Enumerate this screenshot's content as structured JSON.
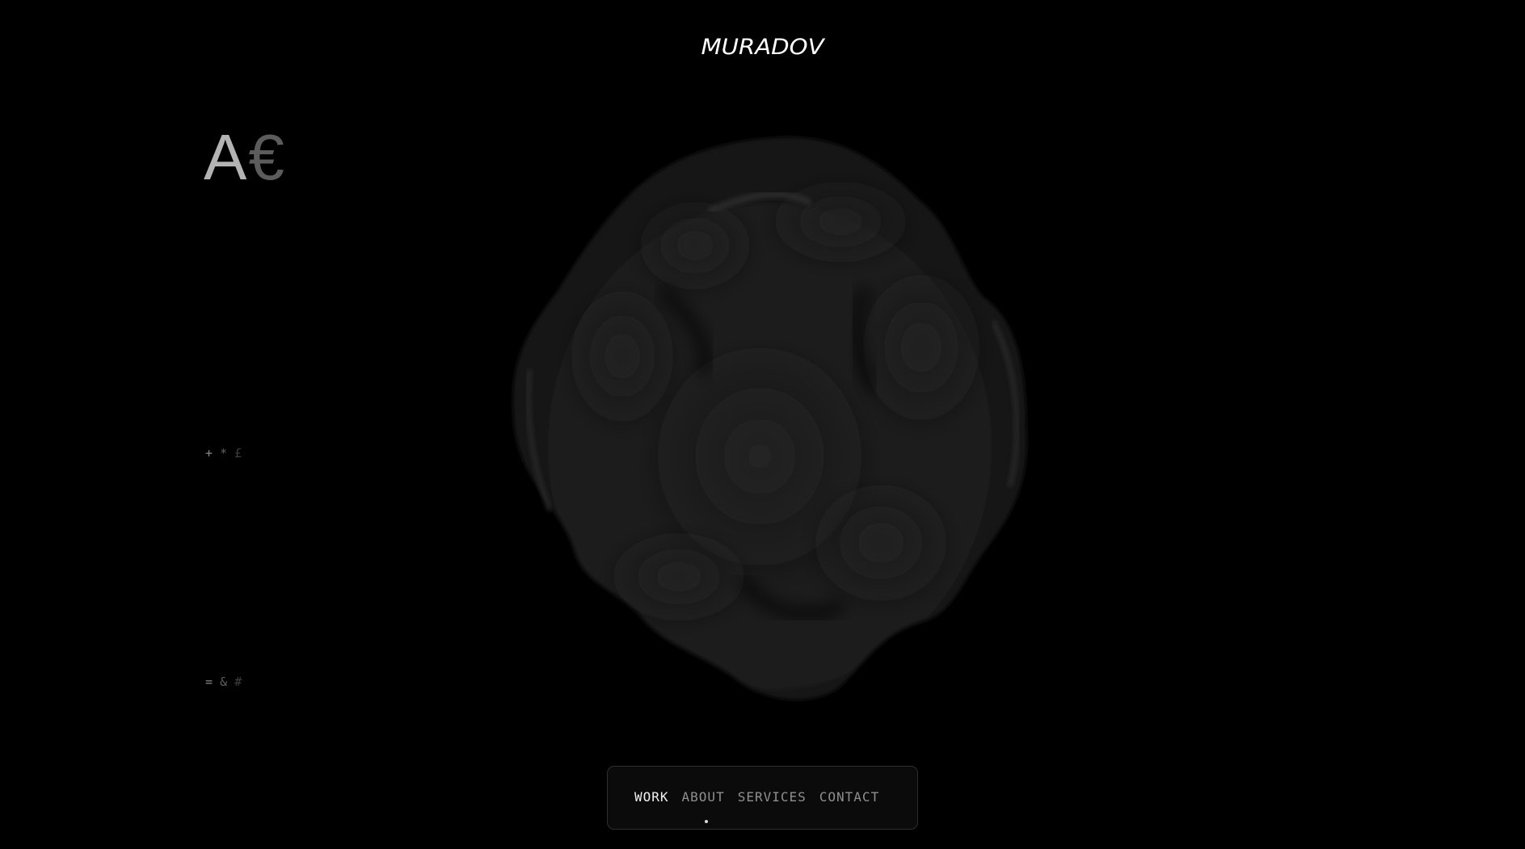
{
  "header": {
    "logo_text": "MURADOV"
  },
  "glyphs": {
    "large": [
      "A",
      "€"
    ],
    "small_top": [
      "+",
      "*",
      "£"
    ],
    "small_bottom": [
      "=",
      "&",
      "#"
    ]
  },
  "nav": {
    "items": [
      {
        "label": "WORK",
        "active": true
      },
      {
        "label": "ABOUT",
        "active": false
      },
      {
        "label": "SERVICES",
        "active": false
      },
      {
        "label": "CONTACT",
        "active": false
      }
    ]
  },
  "colors": {
    "background": "#000000",
    "blob": "#1c1c1c",
    "nav_background": "#0b0b0b",
    "nav_border": "#2e2e2e",
    "active_text": "#f2f2f2",
    "inactive_text": "#8f8f8f"
  }
}
